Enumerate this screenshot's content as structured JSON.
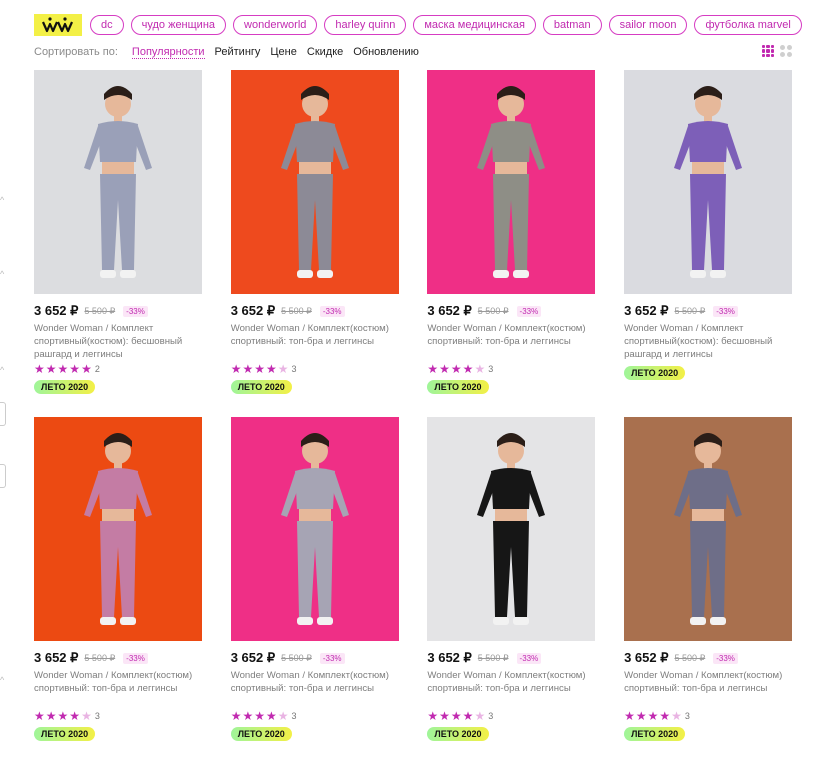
{
  "logo": {
    "icon": "ww-logo",
    "color": "#f3f046"
  },
  "chips": [
    "dc",
    "чудо женщина",
    "wonderworld",
    "harley quinn",
    "маска медицинская",
    "batman",
    "sailor moon",
    "футболка marvel"
  ],
  "sort": {
    "label": "Сортировать по:",
    "options": [
      "Популярности",
      "Рейтингу",
      "Цене",
      "Скидке",
      "Обновлению"
    ],
    "active": "Популярности"
  },
  "view_toggle": {
    "active": "grid-3-icon",
    "inactive": "grid-2-icon"
  },
  "accent_color": "#c12ab0",
  "products": [
    {
      "price": "3 652 ₽",
      "old_price": "5 500 ₽",
      "discount": "-33%",
      "title": "Wonder Woman / Комплект спортивный(костюм): бесшовный рашгард и леггинсы",
      "rating": 5,
      "reviews": "2",
      "badge": "ЛЕТО 2020",
      "bg": "#dcdde0",
      "outfit": "#9aa0b8"
    },
    {
      "price": "3 652 ₽",
      "old_price": "5 500 ₽",
      "discount": "-33%",
      "title": "Wonder Woman / Комплект(костюм) спортивный: топ-бра и леггинсы",
      "rating": 4,
      "reviews": "3",
      "badge": "ЛЕТО 2020",
      "bg": "#ee4a1e",
      "outfit": "#8c8a96"
    },
    {
      "price": "3 652 ₽",
      "old_price": "5 500 ₽",
      "discount": "-33%",
      "title": "Wonder Woman / Комплект(костюм) спортивный: топ-бра и леггинсы",
      "rating": 4,
      "reviews": "3",
      "badge": "ЛЕТО 2020",
      "bg": "#ef2f86",
      "outfit": "#8e8e86"
    },
    {
      "price": "3 652 ₽",
      "old_price": "5 500 ₽",
      "discount": "-33%",
      "title": "Wonder Woman / Комплект спортивный(костюм): бесшовный рашгард и леггинсы",
      "rating": 0,
      "reviews": "",
      "badge": "ЛЕТО 2020",
      "bg": "#dadbe0",
      "outfit": "#7d5fb8"
    },
    {
      "price": "3 652 ₽",
      "old_price": "5 500 ₽",
      "discount": "-33%",
      "title": "Wonder Woman / Комплект(костюм) спортивный: топ-бра и леггинсы",
      "rating": 4,
      "reviews": "3",
      "badge": "ЛЕТО 2020",
      "bg": "#ec4a12",
      "outfit": "#c47ca4"
    },
    {
      "price": "3 652 ₽",
      "old_price": "5 500 ₽",
      "discount": "-33%",
      "title": "Wonder Woman / Комплект(костюм) спортивный: топ-бра и леггинсы",
      "rating": 4,
      "reviews": "3",
      "badge": "ЛЕТО 2020",
      "bg": "#ef2f86",
      "outfit": "#a6a4b4"
    },
    {
      "price": "3 652 ₽",
      "old_price": "5 500 ₽",
      "discount": "-33%",
      "title": "Wonder Woman / Комплект(костюм) спортивный: топ-бра и леггинсы",
      "rating": 4,
      "reviews": "3",
      "badge": "ЛЕТО 2020",
      "bg": "#e4e4e6",
      "outfit": "#161616"
    },
    {
      "price": "3 652 ₽",
      "old_price": "5 500 ₽",
      "discount": "-33%",
      "title": "Wonder Woman / Комплект(костюм) спортивный: топ-бра и леггинсы",
      "rating": 4,
      "reviews": "3",
      "badge": "ЛЕТО 2020",
      "bg": "#a9704e",
      "outfit": "#6e6e88"
    }
  ]
}
